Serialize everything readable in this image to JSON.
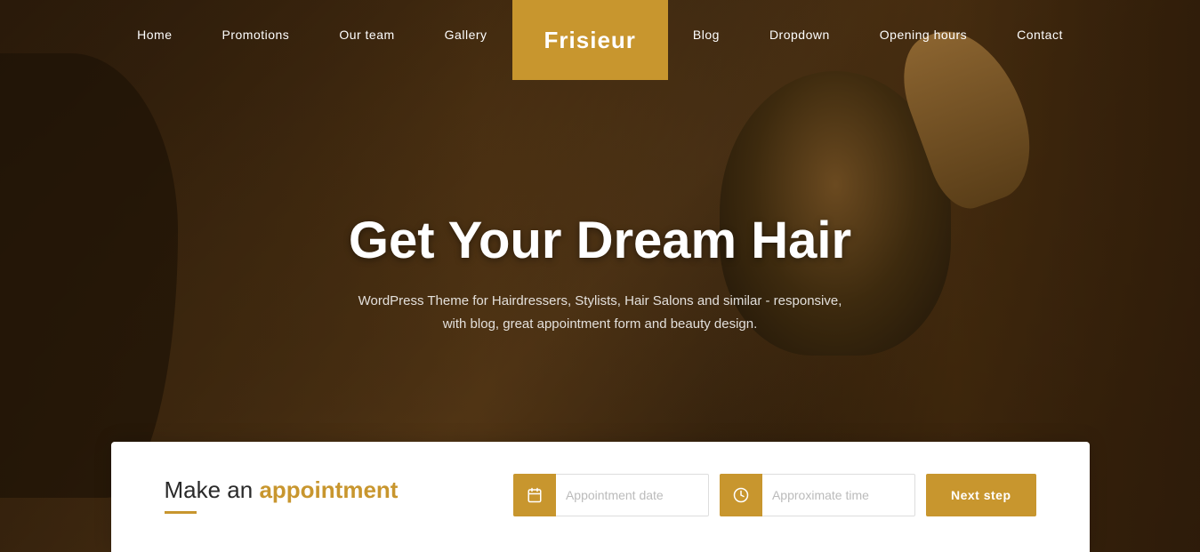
{
  "nav": {
    "links_left": [
      {
        "label": "Home",
        "id": "home"
      },
      {
        "label": "Promotions",
        "id": "promotions"
      },
      {
        "label": "Our team",
        "id": "our-team"
      },
      {
        "label": "Gallery",
        "id": "gallery"
      }
    ],
    "links_right": [
      {
        "label": "Blog",
        "id": "blog"
      },
      {
        "label": "Dropdown",
        "id": "dropdown"
      },
      {
        "label": "Opening hours",
        "id": "opening-hours"
      },
      {
        "label": "Contact",
        "id": "contact"
      }
    ],
    "logo": "Frisieur"
  },
  "hero": {
    "title": "Get Your Dream Hair",
    "subtitle": "WordPress Theme for Hairdressers, Stylists, Hair Salons and similar - responsive, with blog, great appointment form and beauty design."
  },
  "appointment": {
    "heading_plain": "Make an ",
    "heading_accent": "appointment",
    "date_placeholder": "Appointment date",
    "time_placeholder": "Approximate time",
    "button_label": "Next step",
    "date_icon": "📅",
    "time_icon": "⏰"
  }
}
